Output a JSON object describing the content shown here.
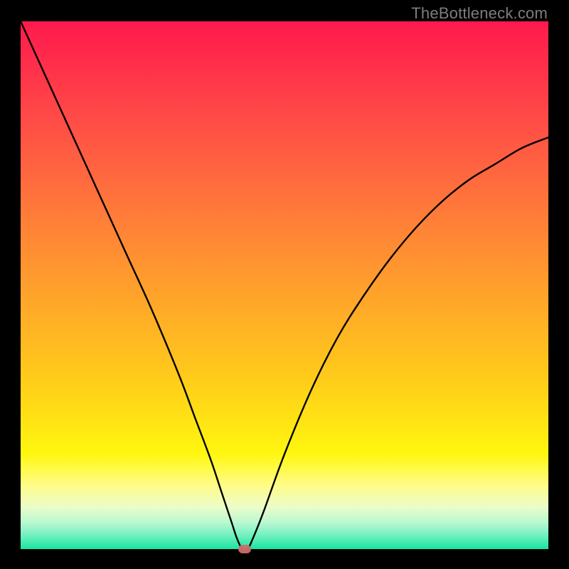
{
  "watermark": "TheBottleneck.com",
  "chart_data": {
    "type": "line",
    "title": "",
    "xlabel": "",
    "ylabel": "",
    "xlim": [
      0,
      100
    ],
    "ylim": [
      0,
      100
    ],
    "grid": false,
    "legend": false,
    "background_gradient": {
      "top": "#ff1a4d",
      "mid": "#ffe414",
      "bottom": "#18e5a0"
    },
    "series": [
      {
        "name": "bottleneck-curve",
        "x": [
          0,
          5,
          10,
          15,
          20,
          25,
          30,
          33,
          36,
          38,
          40,
          41,
          42,
          43,
          44,
          46,
          50,
          55,
          60,
          65,
          70,
          75,
          80,
          85,
          90,
          95,
          100
        ],
        "y": [
          100,
          89,
          78,
          67,
          56,
          45,
          33,
          25,
          17,
          11,
          5,
          2,
          0,
          0,
          2,
          7,
          18,
          30,
          40,
          48,
          55,
          61,
          66,
          70,
          73,
          76,
          78
        ]
      }
    ],
    "marker": {
      "x": 42.5,
      "y": 0,
      "color": "#cc6e6a"
    }
  }
}
